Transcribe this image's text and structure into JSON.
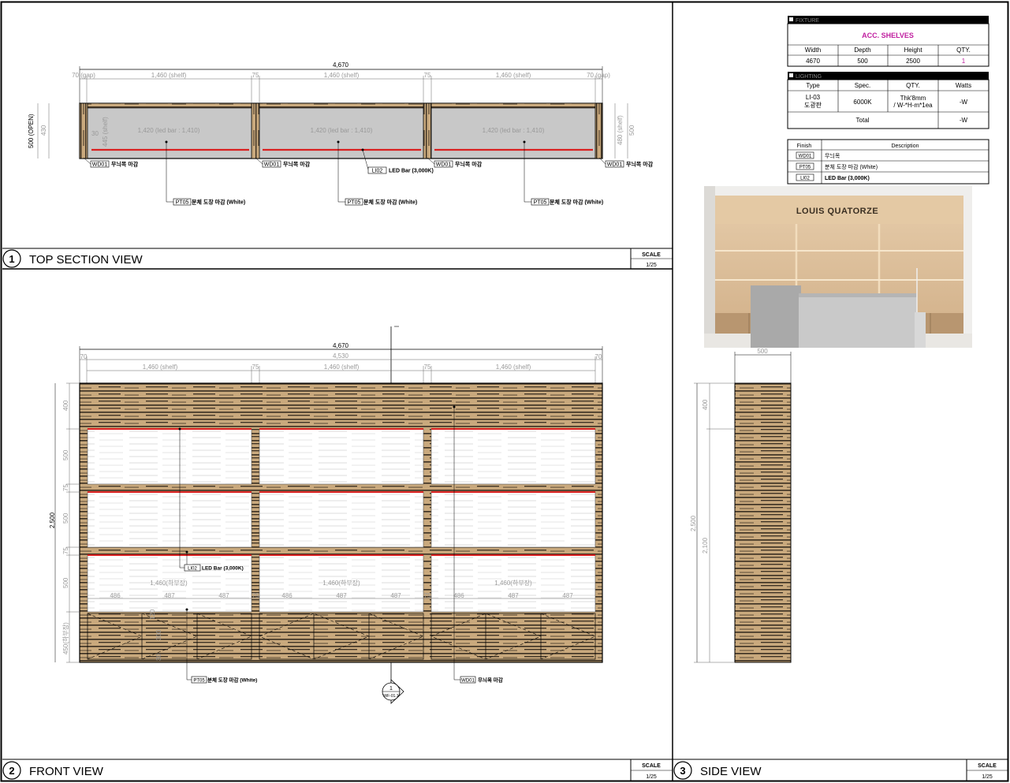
{
  "views": {
    "top": {
      "number": "1",
      "title": "TOP SECTION VIEW",
      "scale_label": "SCALE",
      "scale": "1/25"
    },
    "front": {
      "number": "2",
      "title": "FRONT VIEW",
      "scale_label": "SCALE",
      "scale": "1/25"
    },
    "side": {
      "number": "3",
      "title": "SIDE VIEW",
      "scale_label": "SCALE",
      "scale": "1/25"
    }
  },
  "top_dims": {
    "overall": "4,670",
    "gap_left": "70 (gap)",
    "gap_right": "70 (gap)",
    "shelf": "1,460 (shelf)",
    "post": "75",
    "led": "1,420 (led bar : 1,410)",
    "depth_open": "500 (OPEN)",
    "d430": "430",
    "d445": "445 (shelf)",
    "d500": "500",
    "d480": "480 (shelf)",
    "sm30": "30"
  },
  "top_labels": {
    "wd_code": "WD01",
    "wd_text": "무늬목 마감",
    "pt_code": "PT05",
    "pt_text": "분체 도장 마감 (White)",
    "li_code": "LI02",
    "li_text": "LED Bar (3,000K)"
  },
  "front_dims": {
    "overall": "4,670",
    "inner": "4,530",
    "side70": "70",
    "shelf": "1,460 (shelf)",
    "post": "75",
    "h_total": "2,500",
    "h400": "400",
    "h500": "500",
    "h75": "75",
    "h450": "450(하부장)",
    "lower": "1,460(하부장)",
    "d486": "486",
    "d487": "487",
    "s120": "120",
    "s300": "300",
    "s30": "30"
  },
  "front_labels": {
    "li_code": "LI02",
    "li_text": "LED Bar (3,000K)",
    "pt_code": "PT05",
    "pt_text": "분체 도장 마감 (White)",
    "wd_code": "WD01",
    "wd_text": "무늬목 마감",
    "marker_num": "1",
    "marker_ref": "WF-01.1"
  },
  "side_dims": {
    "depth": "500",
    "h400": "400",
    "h2500": "2,500",
    "h2100": "2,100"
  },
  "fixture_table": {
    "header": "FIXTURE",
    "name": "ACC. SHELVES",
    "cols": [
      "Width",
      "Depth",
      "Height",
      "QTY."
    ],
    "vals": [
      "4670",
      "500",
      "2500",
      "1"
    ]
  },
  "lighting_table": {
    "header": "LIGHTING",
    "cols": [
      "Type",
      "Spec.",
      "QTY.",
      "Watts"
    ],
    "type": "LI-03",
    "type2": "도광판",
    "spec": "6000K",
    "qty1": "Thk'8mm",
    "qty2": "/ W-*H-m*1ea",
    "watts": "-W",
    "total_label": "Total",
    "total": "-W"
  },
  "finish_table": {
    "cols": [
      "Finish",
      "Description"
    ],
    "rows": [
      {
        "code": "WD01",
        "desc": "무늬목"
      },
      {
        "code": "PT05",
        "desc": "분체 도장 마감 (White)"
      },
      {
        "code": "LI02",
        "desc": "LED Bar (3,000K)"
      }
    ]
  },
  "render": {
    "brand": "LOUIS QUATORZE"
  },
  "colors": {
    "wood": "#c9a97d",
    "wood_dark": "#3a2f22",
    "led": "#d92020",
    "accent": "#c020a0",
    "shelf_fill": "#c8c8c8"
  }
}
